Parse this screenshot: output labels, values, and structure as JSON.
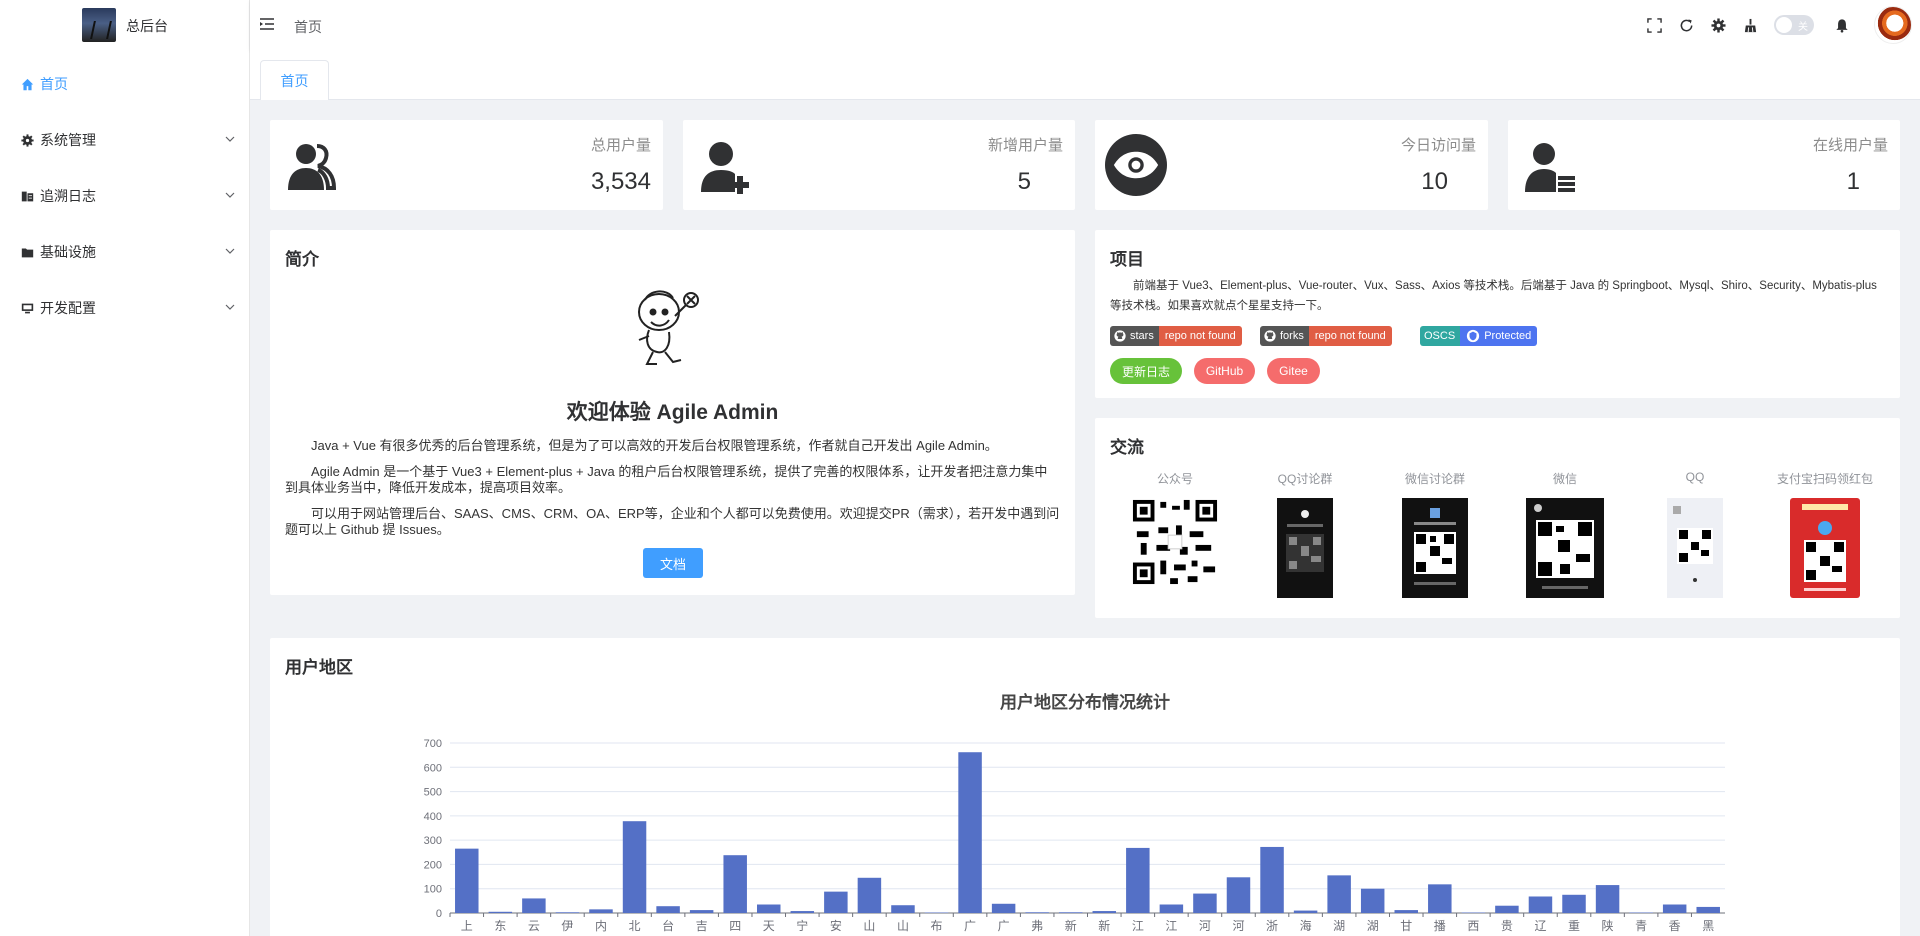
{
  "brand": {
    "title": "总后台"
  },
  "sidebar": {
    "items": [
      {
        "label": "首页",
        "icon": "home-icon",
        "active": true
      },
      {
        "label": "系统管理",
        "icon": "gear-icon"
      },
      {
        "label": "追溯日志",
        "icon": "log-icon"
      },
      {
        "label": "基础设施",
        "icon": "folder-icon"
      },
      {
        "label": "开发配置",
        "icon": "monitor-icon"
      }
    ]
  },
  "header": {
    "breadcrumb": "首页",
    "theme_switch_label": "关"
  },
  "tabs": [
    {
      "label": "首页"
    }
  ],
  "stats": [
    {
      "label": "总用户量",
      "value": "3,534",
      "icon": "users-icon"
    },
    {
      "label": "新增用户量",
      "value": "5",
      "icon": "user-add-icon"
    },
    {
      "label": "今日访问量",
      "value": "10",
      "icon": "eye-icon"
    },
    {
      "label": "在线用户量",
      "value": "1",
      "icon": "user-list-icon"
    }
  ],
  "intro": {
    "title": "简介",
    "welcome": "欢迎体验 Agile Admin",
    "paragraphs": [
      "Java + Vue 有很多优秀的后台管理系统，但是为了可以高效的开发后台权限管理系统，作者就自己开发出 Agile Admin。",
      "Agile Admin 是一个基于 Vue3 + Element-plus + Java 的租户后台权限管理系统，提供了完善的权限体系，让开发者把注意力集中到具体业务当中，降低开发成本，提高项目效率。",
      "可以用于网站管理后台、SAAS、CMS、CRM、OA、ERP等，企业和个人都可以免费使用。欢迎提交PR（需求），若开发中遇到问题可以上 Github 提 Issues。"
    ],
    "doc_button": "文档"
  },
  "project": {
    "title": "项目",
    "description": "前端基于 Vue3、Element-plus、Vue-router、Vux、Sass、Axios 等技术栈。后端基于 Java 的 Springboot、Mysql、Shiro、Security、Mybatis-plus 等技术栈。如果喜欢就点个星星支持一下。",
    "badges": [
      {
        "left": "stars",
        "right": "repo not found"
      },
      {
        "left": "forks",
        "right": "repo not found"
      },
      {
        "left": "OSCS",
        "right": "Protected"
      }
    ],
    "links": [
      {
        "label": "更新日志",
        "color": "#67c23a"
      },
      {
        "label": "GitHub",
        "color": "#f56c6c"
      },
      {
        "label": "Gitee",
        "color": "#f56c6c"
      }
    ]
  },
  "exchange": {
    "title": "交流",
    "items": [
      {
        "label": "公众号"
      },
      {
        "label": "QQ讨论群"
      },
      {
        "label": "微信讨论群"
      },
      {
        "label": "微信"
      },
      {
        "label": "QQ"
      },
      {
        "label": "支付宝扫码领红包"
      }
    ]
  },
  "region": {
    "title": "用户地区"
  },
  "chart_data": {
    "type": "bar",
    "title": "用户地区分布情况统计",
    "color": "#5470c6",
    "ylim": [
      0,
      700
    ],
    "yticks": [
      0,
      100,
      200,
      300,
      400,
      500,
      600,
      700
    ],
    "categories": [
      "上",
      "东",
      "云",
      "伊",
      "内",
      "北",
      "台",
      "吉",
      "四",
      "天",
      "宁",
      "安",
      "山",
      "山",
      "布",
      "广",
      "广",
      "弗",
      "新",
      "新",
      "江",
      "江",
      "河",
      "河",
      "浙",
      "海",
      "湖",
      "湖",
      "甘",
      "播",
      "西",
      "贵",
      "辽",
      "重",
      "陕",
      "青",
      "香",
      "黑"
    ],
    "values": [
      265,
      5,
      60,
      3,
      15,
      378,
      28,
      12,
      238,
      35,
      8,
      88,
      145,
      32,
      2,
      662,
      38,
      3,
      3,
      8,
      268,
      35,
      80,
      147,
      272,
      10,
      155,
      100,
      12,
      118,
      2,
      30,
      68,
      75,
      115,
      2,
      35,
      25
    ]
  }
}
